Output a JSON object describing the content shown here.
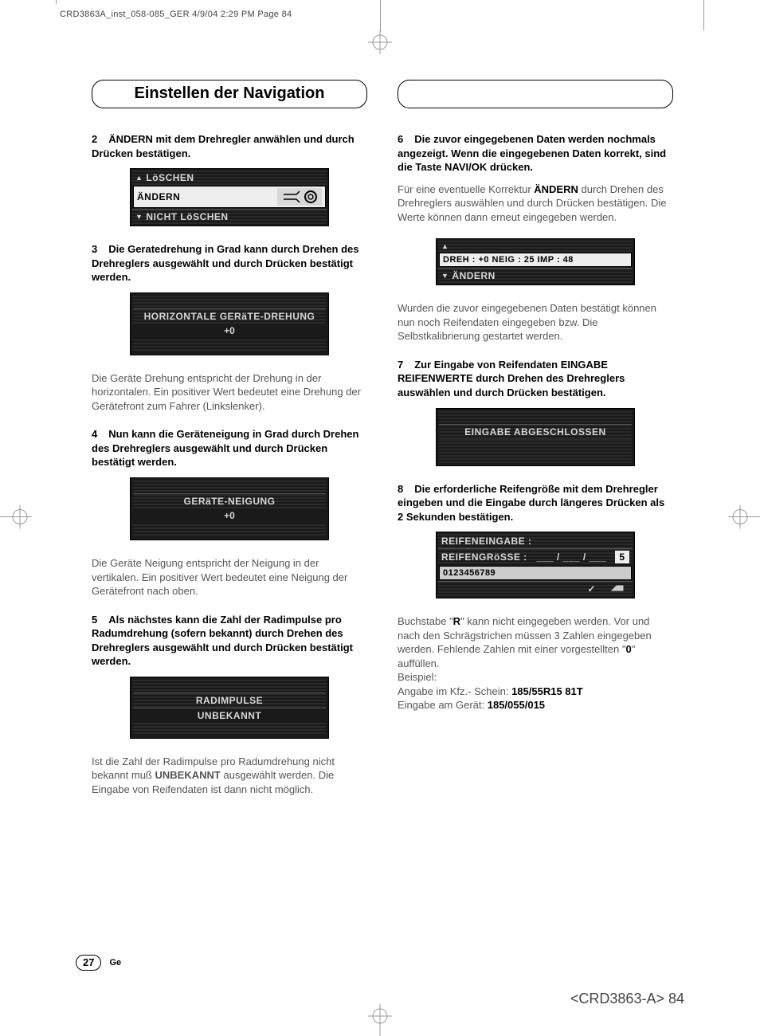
{
  "header_line": "CRD3863A_inst_058-085_GER  4/9/04 2:29 PM  Page 84",
  "section_title": "Einstellen der Navigation",
  "left": {
    "step2": {
      "num": "2",
      "bold1": "ÄNDERN",
      "text": " mit dem Drehregler anwählen und durch Drücken bestätigen."
    },
    "lcd1": {
      "top": "LöSCHEN",
      "mid": "ÄNDERN",
      "bot": "NICHT LöSCHEN"
    },
    "step3": {
      "num": "3",
      "text": "Die Geratedrehung in Grad kann durch Drehen des Drehreglers ausgewählt und durch Drücken bestätigt werden."
    },
    "lcd2": {
      "line1": "HORIZONTALE  GERäTE-DREHUNG",
      "line2": "+0"
    },
    "body3": "Die Geräte Drehung entspricht der Drehung in der horizontalen. Ein positiver Wert bedeutet eine Drehung der Gerätefront zum Fahrer (Linkslenker).",
    "step4": {
      "num": "4",
      "text": "Nun kann die Geräteneigung in Grad durch Drehen des Drehreglers ausgewählt und durch Drücken bestätigt werden."
    },
    "lcd3": {
      "line1": "GERäTE-NEIGUNG",
      "line2": "+0"
    },
    "body4": "Die Geräte Neigung entspricht der Neigung in der vertikalen. Ein positiver Wert bedeutet eine Neigung der Gerätefront nach oben.",
    "step5": {
      "num": "5",
      "text": "Als nächstes kann die Zahl der Radimpulse pro Radumdrehung (sofern bekannt) durch Drehen des Drehreglers ausgewählt und durch Drücken bestätigt werden."
    },
    "lcd4": {
      "line1": "RADIMPULSE",
      "line2": "UNBEKANNT"
    },
    "body5_a": "Ist die Zahl der Radimpulse pro Radumdrehung nicht bekannt muß ",
    "body5_b": "UNBEKANNT",
    "body5_c": " ausgewählt werden. Die Eingabe von Reifendaten ist dann nicht möglich."
  },
  "right": {
    "step6": {
      "num": "6",
      "text_a": "Die zuvor eingegebenen Daten werden nochmals angezeigt. Wenn die eingegebenen Daten korrekt, sind die Taste ",
      "bold": "NAVI/OK",
      "text_b": " drücken."
    },
    "body6_a": "Für eine eventuelle Korrektur ",
    "body6_b": "ÄNDERN",
    "body6_c": " durch Drehen des Drehreglers auswählen und durch Drücken bestätigen. Die Werte können dann erneut eingegeben werden.",
    "lcd5": {
      "mid": "DREH :   +0   NEIG :   25   IMP : 48",
      "bot": "ÄNDERN"
    },
    "body6d": "Wurden die zuvor eingegebenen Daten bestätigt können nun noch Reifendaten eingegeben bzw. Die Selbstkalibrierung gestartet werden.",
    "step7": {
      "num": "7",
      "text_a": "Zur Eingabe von Reifendaten ",
      "bold1": "EINGABE REIFENWERTE",
      "text_b": " durch Drehen des Drehreglers auswählen und durch Drücken bestätigen."
    },
    "lcd6": {
      "line1": "EINGABE  ABGESCHLOSSEN"
    },
    "step8": {
      "num": "8",
      "text": "Die erforderliche Reifengröße mit dem Drehregler eingeben und die Eingabe durch längeres Drücken als 2 Sekunden bestätigen."
    },
    "lcd7": {
      "line1": "REIFENEINGABE :",
      "line2_a": "REIFENGRöSSE :",
      "line2_b": "___ / ___ / ___",
      "box": "5",
      "line3": "0123456789"
    },
    "body8_a": "Buchstabe \"",
    "body8_b": "R",
    "body8_c": "\" kann nicht eingegeben werden. Vor und nach den Schrägstrichen müssen 3 Zahlen eingegeben werden. Fehlende Zahlen mit einer vorgestellten \"",
    "body8_d": "0",
    "body8_e": "\" auffüllen.",
    "body8_f": "Beispiel:",
    "body8_g": "Angabe im Kfz.- Schein: ",
    "body8_h": "185/55R15 81T",
    "body8_i": "Eingabe am Gerät: ",
    "body8_j": "185/055/015"
  },
  "footer": {
    "pagenum": "27",
    "lang": "Ge"
  },
  "docfoot": "<CRD3863-A> 84"
}
